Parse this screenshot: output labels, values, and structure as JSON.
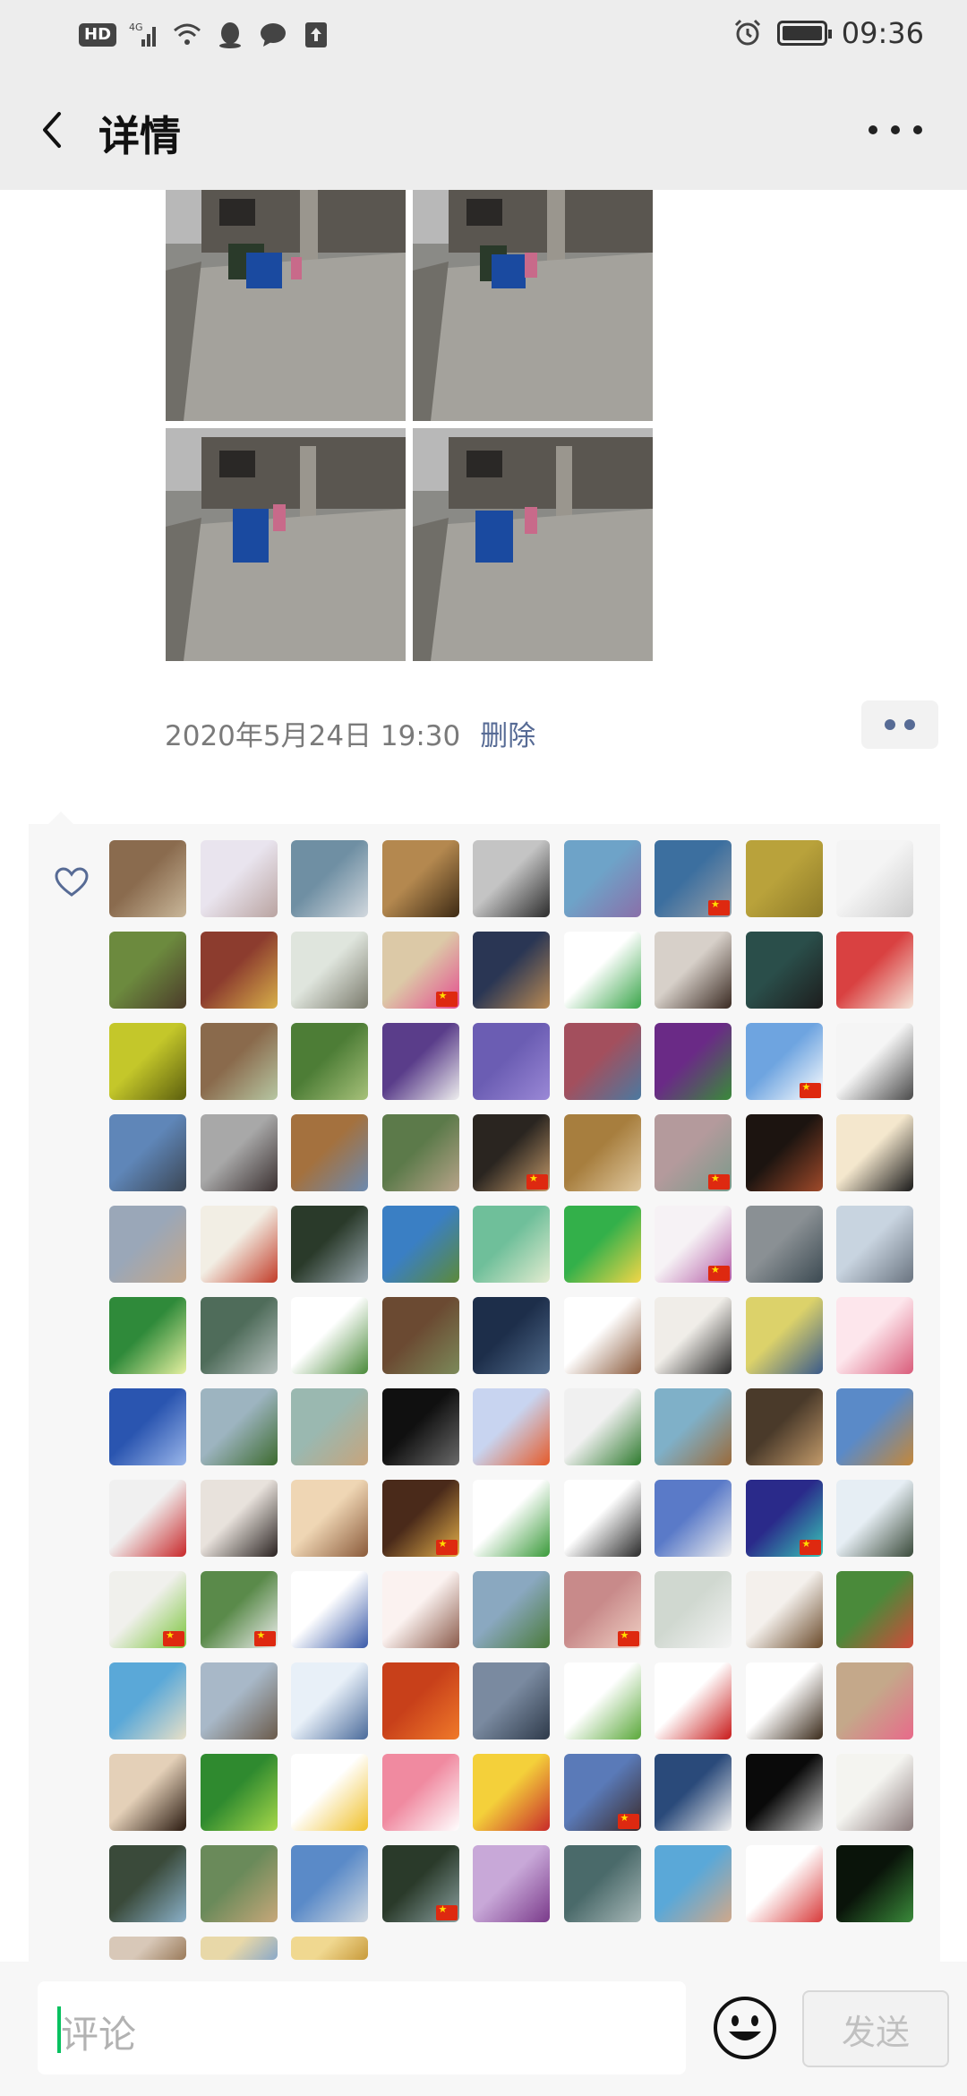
{
  "status_bar": {
    "hd_label": "HD",
    "network_label": "4G",
    "time": "09:36",
    "icons": [
      "hd-icon",
      "signal-icon",
      "wifi-icon",
      "qq-icon",
      "message-icon",
      "upload-icon",
      "alarm-icon",
      "battery-icon"
    ]
  },
  "header": {
    "title": "详情",
    "back_icon": "chevron-left-icon",
    "more_icon": "more-icon"
  },
  "post": {
    "photos": [
      {
        "alt": "photo-1"
      },
      {
        "alt": "photo-2"
      },
      {
        "alt": "photo-3"
      },
      {
        "alt": "photo-4"
      }
    ],
    "timestamp": "2020年5月24日 19:30",
    "delete_label": "删除"
  },
  "likes": {
    "icon": "heart-icon",
    "avatars": [
      {
        "c1": "#8a6b4e",
        "c2": "#c9b79a",
        "flag": false
      },
      {
        "c1": "#e9e4ee",
        "c2": "#b9a3a0",
        "flag": false
      },
      {
        "c1": "#6f8fa3",
        "c2": "#d2d8de",
        "flag": false
      },
      {
        "c1": "#b4884f",
        "c2": "#3d2a14",
        "flag": false
      },
      {
        "c1": "#c4c4c4",
        "c2": "#2c2c2c",
        "flag": false
      },
      {
        "c1": "#6ea3c8",
        "c2": "#8a6fa9",
        "flag": false
      },
      {
        "c1": "#3c6f9f",
        "c2": "#9aa0a8",
        "flag": true
      },
      {
        "c1": "#b9a23b",
        "c2": "#8d7a28",
        "flag": false
      },
      {
        "c1": "#f4f4f4",
        "c2": "#cccccc",
        "flag": false
      },
      {
        "c1": "#6c8a3e",
        "c2": "#4b3b2a",
        "flag": false
      },
      {
        "c1": "#8c3c2e",
        "c2": "#d8b04a",
        "flag": false
      },
      {
        "c1": "#dfe5dd",
        "c2": "#7a7a6c",
        "flag": false
      },
      {
        "c1": "#dcc9a7",
        "c2": "#e44c8f",
        "flag": true
      },
      {
        "c1": "#2a3654",
        "c2": "#b98a54",
        "flag": false
      },
      {
        "c1": "#ffffff",
        "c2": "#3aa54a",
        "flag": false
      },
      {
        "c1": "#d7d0c9",
        "c2": "#3a2a22",
        "flag": false
      },
      {
        "c1": "#2a4e4a",
        "c2": "#1d1d1d",
        "flag": false
      },
      {
        "c1": "#d94141",
        "c2": "#f5e6da",
        "flag": false
      },
      {
        "c1": "#c4c72a",
        "c2": "#5c5f0e",
        "flag": false
      },
      {
        "c1": "#8a6a4c",
        "c2": "#b7c7a3",
        "flag": false
      },
      {
        "c1": "#4d7d36",
        "c2": "#a7c17a",
        "flag": false
      },
      {
        "c1": "#5a3d8a",
        "c2": "#eeeeee",
        "flag": false
      },
      {
        "c1": "#6b5db3",
        "c2": "#9a88d6",
        "flag": false
      },
      {
        "c1": "#a34f5d",
        "c2": "#4b79a0",
        "flag": false
      },
      {
        "c1": "#6a2a86",
        "c2": "#3a8a3a",
        "flag": false
      },
      {
        "c1": "#6ea4e0",
        "c2": "#ffffff",
        "flag": true
      },
      {
        "c1": "#f5f5f5",
        "c2": "#4a4a4a",
        "flag": false
      },
      {
        "c1": "#5f86b8",
        "c2": "#3b4654",
        "flag": false
      },
      {
        "c1": "#a8a8a8",
        "c2": "#3a3030",
        "flag": false
      },
      {
        "c1": "#a4713e",
        "c2": "#6c8ab0",
        "flag": false
      },
      {
        "c1": "#5c7a4a",
        "c2": "#b8a48a",
        "flag": false
      },
      {
        "c1": "#2a2520",
        "c2": "#c49a6a",
        "flag": true
      },
      {
        "c1": "#a77e3e",
        "c2": "#e0c9a0",
        "flag": false
      },
      {
        "c1": "#b49a9c",
        "c2": "#7a9a8a",
        "flag": true
      },
      {
        "c1": "#1c1410",
        "c2": "#a04a2a",
        "flag": false
      },
      {
        "c1": "#f4e7cd",
        "c2": "#1a1a1a",
        "flag": false
      },
      {
        "c1": "#9aa7b8",
        "c2": "#c4a78a",
        "flag": false
      },
      {
        "c1": "#f2eee4",
        "c2": "#c23c28",
        "flag": false
      },
      {
        "c1": "#2a3a2a",
        "c2": "#9aa8b0",
        "flag": false
      },
      {
        "c1": "#3a7fc4",
        "c2": "#5c8a3a",
        "flag": false
      },
      {
        "c1": "#6fbf9a",
        "c2": "#e3ecd0",
        "flag": false
      },
      {
        "c1": "#33b04a",
        "c2": "#f2d648",
        "flag": false
      },
      {
        "c1": "#f6f2f5",
        "c2": "#b35aa5",
        "flag": true
      },
      {
        "c1": "#8a9094",
        "c2": "#3c4a52",
        "flag": false
      },
      {
        "c1": "#c8d4e0",
        "c2": "#6a7480",
        "flag": false
      },
      {
        "c1": "#2f8a3a",
        "c2": "#e5f0a0",
        "flag": false
      },
      {
        "c1": "#4f6c5a",
        "c2": "#b8c2c0",
        "flag": false
      },
      {
        "c1": "#ffffff",
        "c2": "#4a8a3a",
        "flag": false
      },
      {
        "c1": "#6b4a32",
        "c2": "#7c8a5a",
        "flag": false
      },
      {
        "c1": "#1d2e4a",
        "c2": "#506a8a",
        "flag": false
      },
      {
        "c1": "#ffffff",
        "c2": "#8a5a3c",
        "flag": false
      },
      {
        "c1": "#f0ede8",
        "c2": "#2a2a2a",
        "flag": false
      },
      {
        "c1": "#dcd26a",
        "c2": "#3a5a8a",
        "flag": false
      },
      {
        "c1": "#fde6ec",
        "c2": "#d95c7a",
        "flag": false
      },
      {
        "c1": "#2a55b0",
        "c2": "#9ab6ea",
        "flag": false
      },
      {
        "c1": "#9db4c0",
        "c2": "#3c6a2e",
        "flag": false
      },
      {
        "c1": "#9ab8b0",
        "c2": "#c7a47c",
        "flag": false
      },
      {
        "c1": "#101010",
        "c2": "#6a6a6a",
        "flag": false
      },
      {
        "c1": "#c8d4f0",
        "c2": "#e55a2a",
        "flag": false
      },
      {
        "c1": "#f0f0f0",
        "c2": "#2e7a2e",
        "flag": false
      },
      {
        "c1": "#7fb0c8",
        "c2": "#9a6a3a",
        "flag": false
      },
      {
        "c1": "#4a3a2a",
        "c2": "#c29a6a",
        "flag": false
      },
      {
        "c1": "#5a8ac8",
        "c2": "#c4883a",
        "flag": false
      },
      {
        "c1": "#f0f0f0",
        "c2": "#c8282a",
        "flag": false
      },
      {
        "c1": "#e8e2dc",
        "c2": "#2a2220",
        "flag": false
      },
      {
        "c1": "#efd6b4",
        "c2": "#8a5a3a",
        "flag": false
      },
      {
        "c1": "#4a2a1a",
        "c2": "#e4b04a",
        "flag": true
      },
      {
        "c1": "#ffffff",
        "c2": "#3a9a3a",
        "flag": false
      },
      {
        "c1": "#ffffff",
        "c2": "#2a2a2a",
        "flag": false
      },
      {
        "c1": "#5a7ac8",
        "c2": "#f0f0f0",
        "flag": false
      },
      {
        "c1": "#2a2a8a",
        "c2": "#3ac8b8",
        "flag": true
      },
      {
        "c1": "#e6eef4",
        "c2": "#3a4a3a",
        "flag": false
      },
      {
        "c1": "#f0f0ec",
        "c2": "#7ac43a",
        "flag": true
      },
      {
        "c1": "#5a8a4a",
        "c2": "#eeeeee",
        "flag": true
      },
      {
        "c1": "#ffffff",
        "c2": "#3a5aa8",
        "flag": false
      },
      {
        "c1": "#fbf2f0",
        "c2": "#8a5a4a",
        "flag": false
      },
      {
        "c1": "#8aa8c0",
        "c2": "#4a7a3a",
        "flag": false
      },
      {
        "c1": "#c88a8a",
        "c2": "#f0d0c4",
        "flag": true
      },
      {
        "c1": "#d0d8d0",
        "c2": "#f4f4f4",
        "flag": false
      },
      {
        "c1": "#f4f0ec",
        "c2": "#6a4a2a",
        "flag": false
      },
      {
        "c1": "#4a8a3a",
        "c2": "#d24a3a",
        "flag": false
      },
      {
        "c1": "#5aa8d8",
        "c2": "#e8e0c8",
        "flag": false
      },
      {
        "c1": "#a8b8c8",
        "c2": "#6a5a4a",
        "flag": false
      },
      {
        "c1": "#e8f0f8",
        "c2": "#4a6a9a",
        "flag": false
      },
      {
        "c1": "#c8401a",
        "c2": "#f07a2a",
        "flag": false
      },
      {
        "c1": "#7a8aa0",
        "c2": "#2e3a4a",
        "flag": false
      },
      {
        "c1": "#ffffff",
        "c2": "#5aa83a",
        "flag": false
      },
      {
        "c1": "#ffffff",
        "c2": "#c81a1a",
        "flag": false
      },
      {
        "c1": "#ffffff",
        "c2": "#3a2a1a",
        "flag": false
      },
      {
        "c1": "#c4a88a",
        "c2": "#e86a8a",
        "flag": false
      },
      {
        "c1": "#e4d0b8",
        "c2": "#2a1a10",
        "flag": false
      },
      {
        "c1": "#2f8a2f",
        "c2": "#a8d84a",
        "flag": false
      },
      {
        "c1": "#ffffff",
        "c2": "#f0c02a",
        "flag": false
      },
      {
        "c1": "#f08aa0",
        "c2": "#ffffff",
        "flag": false
      },
      {
        "c1": "#f4d03a",
        "c2": "#c82a2a",
        "flag": false
      },
      {
        "c1": "#5a7ab8",
        "c2": "#3a2a2a",
        "flag": true
      },
      {
        "c1": "#2a4a7a",
        "c2": "#f0f0f0",
        "flag": false
      },
      {
        "c1": "#0a0a0a",
        "c2": "#cccccc",
        "flag": false
      },
      {
        "c1": "#f4f4f0",
        "c2": "#8a7a7a",
        "flag": false
      },
      {
        "c1": "#3a4a3a",
        "c2": "#8ab0c8",
        "flag": false
      },
      {
        "c1": "#6a8a5a",
        "c2": "#c8a87a",
        "flag": false
      },
      {
        "c1": "#5a8ac8",
        "c2": "#d0d8e0",
        "flag": false
      },
      {
        "c1": "#2a3a2a",
        "c2": "#8aa0a0",
        "flag": true
      },
      {
        "c1": "#c8a8d8",
        "c2": "#7a3a8a",
        "flag": false
      },
      {
        "c1": "#4a6a6a",
        "c2": "#a8b8b8",
        "flag": false
      },
      {
        "c1": "#5aa8d8",
        "c2": "#d0a88a",
        "flag": false
      },
      {
        "c1": "#ffffff",
        "c2": "#d83a3a",
        "flag": false
      },
      {
        "c1": "#0a140a",
        "c2": "#3a8a3a",
        "flag": false
      },
      {
        "c1": "#d8c8b8",
        "c2": "#9a7a5a",
        "flag": false
      },
      {
        "c1": "#e8d8a8",
        "c2": "#8aa8c8",
        "flag": false
      },
      {
        "c1": "#f0d890",
        "c2": "#c89a3a",
        "flag": false
      }
    ]
  },
  "comment_bar": {
    "placeholder": "评论",
    "emoji_icon": "emoji-icon",
    "send_label": "发送"
  }
}
